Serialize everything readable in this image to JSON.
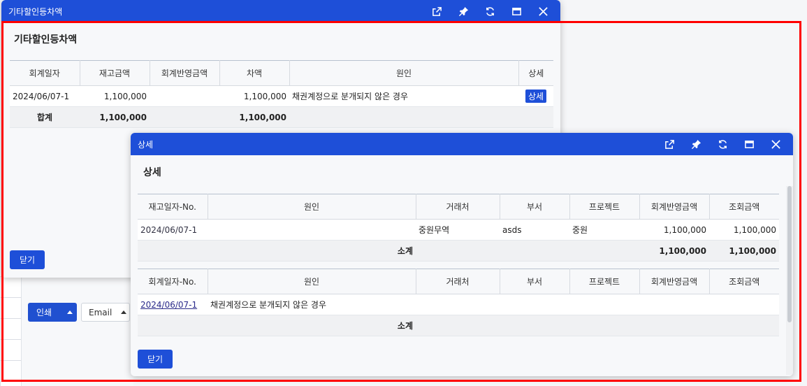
{
  "background": {
    "print_label": "인쇄",
    "email_label": "Email"
  },
  "window1": {
    "title": "기타할인등차액",
    "heading": "기타할인등차액",
    "columns": [
      "회계일자",
      "재고금액",
      "회계반영금액",
      "차액",
      "원인",
      "상세"
    ],
    "rows": [
      {
        "date": "2024/06/07-1",
        "stock": "1,100,000",
        "acct": "",
        "diff": "1,100,000",
        "reason": "채권계정으로 분개되지 않은 경우",
        "detail": "상세"
      }
    ],
    "sum": {
      "label": "합계",
      "stock": "1,100,000",
      "diff": "1,100,000"
    },
    "close_label": "닫기"
  },
  "window2": {
    "title": "상세",
    "heading": "상세",
    "table1": {
      "columns": [
        "재고일자-No.",
        "원인",
        "거래처",
        "부서",
        "프로젝트",
        "회계반영금액",
        "조회금액"
      ],
      "rows": [
        {
          "date": "2024/06/07-1",
          "reason": "",
          "client": "중원무역",
          "dept": "asds",
          "project": "중원",
          "acct": "1,100,000",
          "query": "1,100,000"
        }
      ],
      "sum": {
        "label": "소계",
        "acct": "1,100,000",
        "query": "1,100,000"
      }
    },
    "table2": {
      "columns": [
        "회계일자-No.",
        "원인",
        "거래처",
        "부서",
        "프로젝트",
        "회계반영금액",
        "조회금액"
      ],
      "rows": [
        {
          "date": "2024/06/07-1",
          "reason": "채권계정으로 분개되지 않은 경우",
          "client": "",
          "dept": "",
          "project": "",
          "acct": "",
          "query": ""
        }
      ],
      "sum": {
        "label": "소계"
      }
    },
    "close_label": "닫기"
  },
  "colors": {
    "titlebar": "#1e4fd8",
    "selection": "#ff0000"
  },
  "icons": [
    "popout-icon",
    "pin-icon",
    "refresh-icon",
    "maximize-icon",
    "close-icon"
  ]
}
